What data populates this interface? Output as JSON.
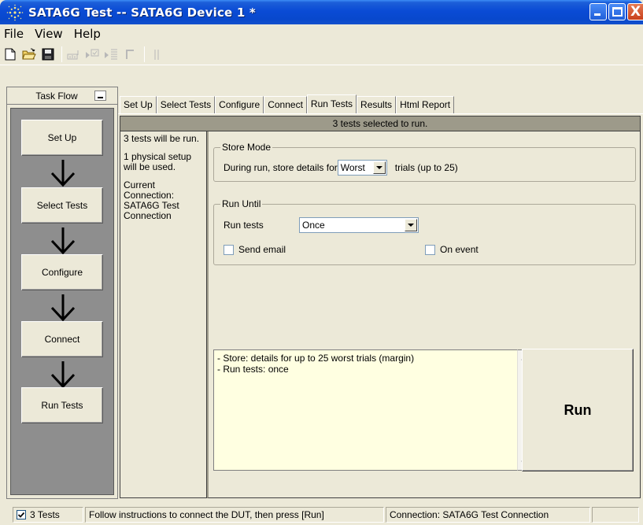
{
  "window": {
    "title": "SATA6G Test -- SATA6G Device 1 *",
    "close_glyph": "X"
  },
  "menu": {
    "items": [
      "File",
      "View",
      "Help"
    ]
  },
  "toolbar": {
    "icons": [
      "new-icon",
      "open-icon",
      "save-icon",
      "disabled-icon-1",
      "disabled-icon-2",
      "disabled-icon-3",
      "disabled-icon-4",
      "disabled-icon-5"
    ]
  },
  "taskflow": {
    "title": "Task Flow",
    "steps": [
      "Set Up",
      "Select Tests",
      "Configure",
      "Connect",
      "Run Tests"
    ]
  },
  "tabs": {
    "items": [
      "Set Up",
      "Select Tests",
      "Configure",
      "Connect",
      "Run Tests",
      "Results",
      "Html Report"
    ],
    "active": "Run Tests"
  },
  "run_tests": {
    "banner": "3 tests selected to run.",
    "info": {
      "tests_line": "3 tests will be run.",
      "setup_line": "1 physical setup will be used.",
      "connection_label": "Current Connection:",
      "connection_name": "SATA6G Test Connection"
    },
    "store_mode": {
      "legend": "Store Mode",
      "prefix": "During run, store details for",
      "value": "Worst",
      "suffix": "trials (up to 25)"
    },
    "run_until": {
      "legend": "Run Until",
      "run_tests_label": "Run tests",
      "run_tests_value": "Once",
      "send_email_label": "Send email",
      "send_email_checked": false,
      "on_event_label": "On event",
      "on_event_checked": false
    },
    "summary": {
      "line1": "- Store: details for up to 25 worst trials (margin)",
      "line2": "- Run tests: once"
    },
    "run_button": "Run"
  },
  "statusbar": {
    "tests_count": "3 Tests",
    "tests_checked": true,
    "message": "Follow instructions to connect the DUT, then press [Run]",
    "connection": "Connection: SATA6G Test Connection"
  }
}
